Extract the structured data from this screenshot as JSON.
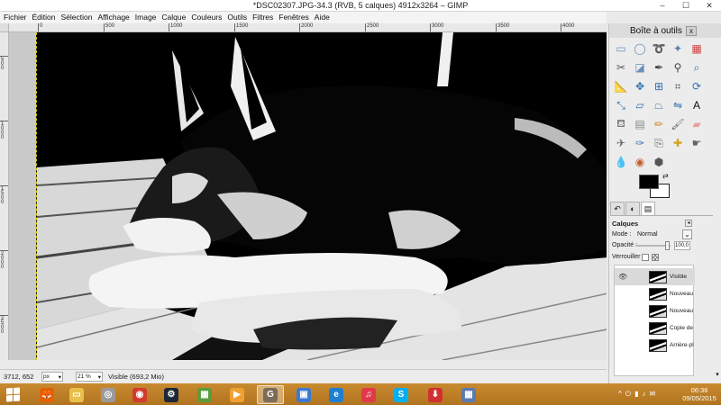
{
  "window": {
    "title": "*DSC02307.JPG-34.3 (RVB, 5 calques) 4912x3264 – GIMP",
    "min": "–",
    "max": "☐",
    "close": "✕"
  },
  "menu": [
    "Fichier",
    "Édition",
    "Sélection",
    "Affichage",
    "Image",
    "Calque",
    "Couleurs",
    "Outils",
    "Filtres",
    "Fenêtres",
    "Aide"
  ],
  "ruler": {
    "top_ticks": [
      "0",
      "500",
      "1000",
      "1500",
      "2000",
      "2500",
      "3000",
      "3500",
      "4000"
    ],
    "left_ticks": [
      "500",
      "1000",
      "1500",
      "2000",
      "2500"
    ]
  },
  "status": {
    "coords": "3712, 652",
    "unit": "px",
    "zoom": "21 %",
    "info": "Visible (693,2 Mio)"
  },
  "dock": {
    "title": "Boîte à outils",
    "close": "x",
    "tools": [
      {
        "name": "rect-select-icon",
        "glyph": "▭",
        "color": "#6a8fbf"
      },
      {
        "name": "ellipse-select-icon",
        "glyph": "◯",
        "color": "#6a8fbf"
      },
      {
        "name": "lasso-icon",
        "glyph": "➰",
        "color": "#6a8fbf"
      },
      {
        "name": "fuzzy-select-icon",
        "glyph": "✦",
        "color": "#5a7fb0"
      },
      {
        "name": "color-select-icon",
        "glyph": "▦",
        "color": "#c44"
      },
      {
        "name": "scissors-icon",
        "glyph": "✂",
        "color": "#555"
      },
      {
        "name": "foreground-select-icon",
        "glyph": "◪",
        "color": "#6a8fbf"
      },
      {
        "name": "paths-icon",
        "glyph": "✒",
        "color": "#444"
      },
      {
        "name": "color-picker-icon",
        "glyph": "⚲",
        "color": "#444"
      },
      {
        "name": "zoom-icon",
        "glyph": "⌕",
        "color": "#2e6fb0"
      },
      {
        "name": "measure-icon",
        "glyph": "📐",
        "color": "#666"
      },
      {
        "name": "move-icon",
        "glyph": "✥",
        "color": "#2e6fb0"
      },
      {
        "name": "align-icon",
        "glyph": "⊞",
        "color": "#2e6fb0"
      },
      {
        "name": "crop-icon",
        "glyph": "⌗",
        "color": "#555"
      },
      {
        "name": "rotate-icon",
        "glyph": "⟳",
        "color": "#2e6fb0"
      },
      {
        "name": "scale-icon",
        "glyph": "⤡",
        "color": "#2e6fb0"
      },
      {
        "name": "shear-icon",
        "glyph": "▱",
        "color": "#2e6fb0"
      },
      {
        "name": "perspective-icon",
        "glyph": "⏢",
        "color": "#2e6fb0"
      },
      {
        "name": "flip-icon",
        "glyph": "⇋",
        "color": "#2e6fb0"
      },
      {
        "name": "text-icon",
        "glyph": "A",
        "color": "#111"
      },
      {
        "name": "bucket-fill-icon",
        "glyph": "⛾",
        "color": "#777"
      },
      {
        "name": "gradient-icon",
        "glyph": "▤",
        "color": "#888"
      },
      {
        "name": "pencil-icon",
        "glyph": "✏",
        "color": "#c98a2f"
      },
      {
        "name": "paintbrush-icon",
        "glyph": "🖌",
        "color": "#666"
      },
      {
        "name": "eraser-icon",
        "glyph": "▰",
        "color": "#e8a0a0"
      },
      {
        "name": "airbrush-icon",
        "glyph": "✈",
        "color": "#666"
      },
      {
        "name": "ink-icon",
        "glyph": "✑",
        "color": "#2e6fb0"
      },
      {
        "name": "clone-icon",
        "glyph": "⎘",
        "color": "#666"
      },
      {
        "name": "heal-icon",
        "glyph": "✚",
        "color": "#d4a017"
      },
      {
        "name": "smudge-icon",
        "glyph": "☛",
        "color": "#666"
      },
      {
        "name": "blur-icon",
        "glyph": "💧",
        "color": "#2e6fb0"
      },
      {
        "name": "dodge-burn-icon",
        "glyph": "◉",
        "color": "#c0622f"
      },
      {
        "name": "cage-icon",
        "glyph": "⬢",
        "color": "#555"
      }
    ],
    "swap_glyph": "⇄",
    "tabs": [
      "↶",
      "◐",
      "▤"
    ],
    "layers": {
      "header": "Calques",
      "menu": "◂",
      "mode_label": "Mode :",
      "mode_value": "Normal",
      "mode_btn": "⌄",
      "opacity_label": "Opacité :",
      "opacity_value": "100,0",
      "opacity_fraction": 0.9,
      "lock_label": "Verrouiller :",
      "items": [
        {
          "name": "Visible",
          "visible": true,
          "selected": true
        },
        {
          "name": "Nouveau",
          "visible": false,
          "selected": false
        },
        {
          "name": "Nouveau",
          "visible": false,
          "selected": false
        },
        {
          "name": "Copie de",
          "visible": false,
          "selected": false
        },
        {
          "name": "Arrière-pl",
          "visible": false,
          "selected": false
        }
      ],
      "eye_glyph": "👁",
      "scroll_down": "▾"
    }
  },
  "taskbar": {
    "apps": [
      {
        "name": "firefox-icon",
        "glyph": "🦊",
        "color": "#e66000",
        "active": false
      },
      {
        "name": "file-explorer-icon",
        "glyph": "▭",
        "color": "#e8c04a",
        "active": false
      },
      {
        "name": "chrome-like-icon",
        "glyph": "◎",
        "color": "#9a9a9a",
        "active": false
      },
      {
        "name": "chrome-icon",
        "glyph": "◉",
        "color": "#d23b2c",
        "active": false
      },
      {
        "name": "steam-icon",
        "glyph": "⚙",
        "color": "#1b2838",
        "active": false
      },
      {
        "name": "minecraft-icon",
        "glyph": "▦",
        "color": "#5a9b3a",
        "active": false
      },
      {
        "name": "media-player-icon",
        "glyph": "▶",
        "color": "#f0a030",
        "active": false
      },
      {
        "name": "gimp-icon",
        "glyph": "G",
        "color": "#7d6b5a",
        "active": true
      },
      {
        "name": "photos-icon",
        "glyph": "▣",
        "color": "#3a7ad0",
        "active": false
      },
      {
        "name": "internet-explorer-icon",
        "glyph": "e",
        "color": "#1e7fd0",
        "active": false
      },
      {
        "name": "itunes-icon",
        "glyph": "♫",
        "color": "#e03a4a",
        "active": false
      },
      {
        "name": "skype-icon",
        "glyph": "S",
        "color": "#00aff0",
        "active": false
      },
      {
        "name": "download-icon",
        "glyph": "⬇",
        "color": "#d03030",
        "active": false
      },
      {
        "name": "control-panel-icon",
        "glyph": "▦",
        "color": "#5a7ab0",
        "active": false
      }
    ],
    "tray": [
      "^",
      "⏻",
      "▮",
      "♪",
      "✉"
    ],
    "time": "06:36",
    "date": "09/05/2015"
  }
}
